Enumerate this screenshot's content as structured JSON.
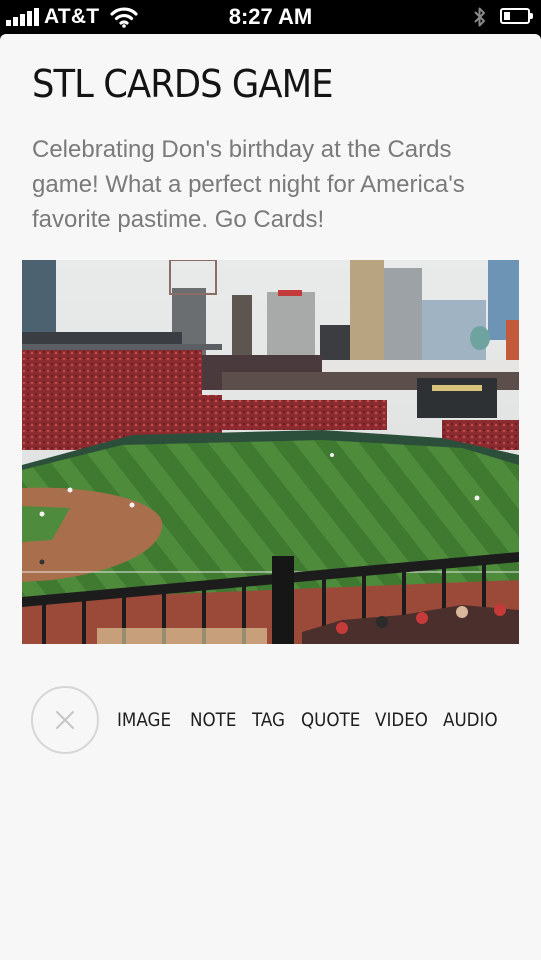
{
  "status_bar": {
    "carrier": "AT&T",
    "time": "8:27 AM",
    "signal_bars": 5,
    "battery_level": 0.25,
    "icons": [
      "signal-bars-icon",
      "wifi-icon",
      "bluetooth-icon",
      "battery-icon"
    ]
  },
  "post": {
    "title": "STL CARDS GAME",
    "caption": "Celebrating Don's birthday at the Cards game! What a perfect night for America's favorite pastime. Go Cards!",
    "image_subject": "ballpark-photo"
  },
  "post_type_menu": {
    "close_icon": "close-icon",
    "items": [
      "IMAGE",
      "NOTE",
      "TAG",
      "QUOTE",
      "VIDEO",
      "AUDIO"
    ]
  },
  "colors": {
    "background": "#f7f7f7",
    "title": "#141414",
    "caption": "#7a7a7a",
    "menu_text": "#1f1f1f",
    "circle_border": "#d6d6d6"
  }
}
